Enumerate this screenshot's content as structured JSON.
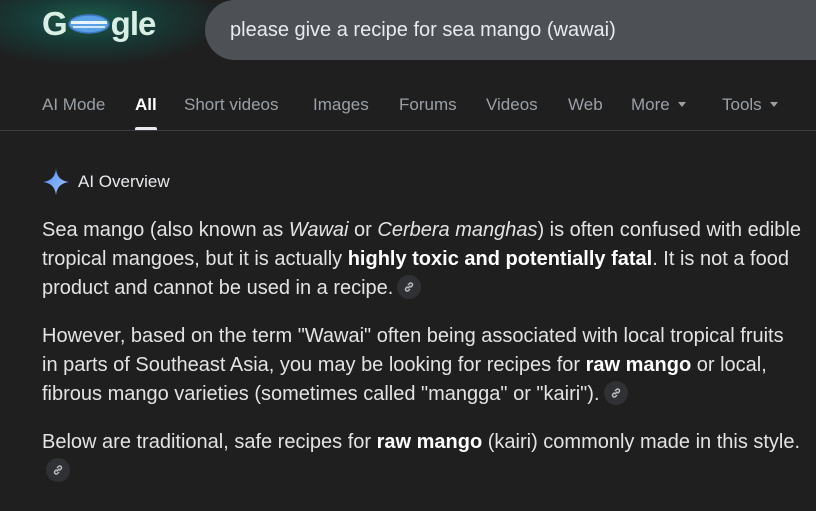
{
  "header": {
    "logo_text": "Google",
    "search": {
      "value": "please give a recipe for sea mango (wawai)",
      "placeholder": ""
    }
  },
  "tabs": [
    {
      "label": "AI Mode",
      "active": false
    },
    {
      "label": "All",
      "active": true
    },
    {
      "label": "Short videos",
      "active": false
    },
    {
      "label": "Images",
      "active": false
    },
    {
      "label": "Forums",
      "active": false
    },
    {
      "label": "Videos",
      "active": false
    },
    {
      "label": "Web",
      "active": false
    },
    {
      "label": "More",
      "active": false,
      "dropdown": true
    },
    {
      "label": "Tools",
      "active": false,
      "dropdown": true
    }
  ],
  "ai_overview": {
    "title": "AI Overview",
    "icon": "sparkle-icon",
    "accent_color": "#8ab4f8",
    "p1": {
      "t1": "Sea mango (also known as ",
      "i1": "Wawai",
      "t2": " or ",
      "i2": "Cerbera manghas",
      "t3": ") is often confused with edible tropical mangoes, but it is actually ",
      "b1": "highly toxic and potentially fatal",
      "t4": ". It is not a food product and cannot be used in a recipe."
    },
    "p2": {
      "t1": "However, based on the term \"Wawai\" often being associated with local tropical fruits in parts of Southeast Asia, you may be looking for recipes for ",
      "b1": "raw mango",
      "t2": " or local, fibrous mango varieties (sometimes called \"mangga\" or \"kairi\")."
    },
    "p3": {
      "t1": "Below are traditional, safe recipes for ",
      "b1": "raw mango",
      "t2": " (kairi) commonly made in this style."
    }
  },
  "colors": {
    "background": "#1f1f1f",
    "searchbox": "#4d5156",
    "text": "#e3e3e3",
    "muted": "#9aa0a6"
  }
}
